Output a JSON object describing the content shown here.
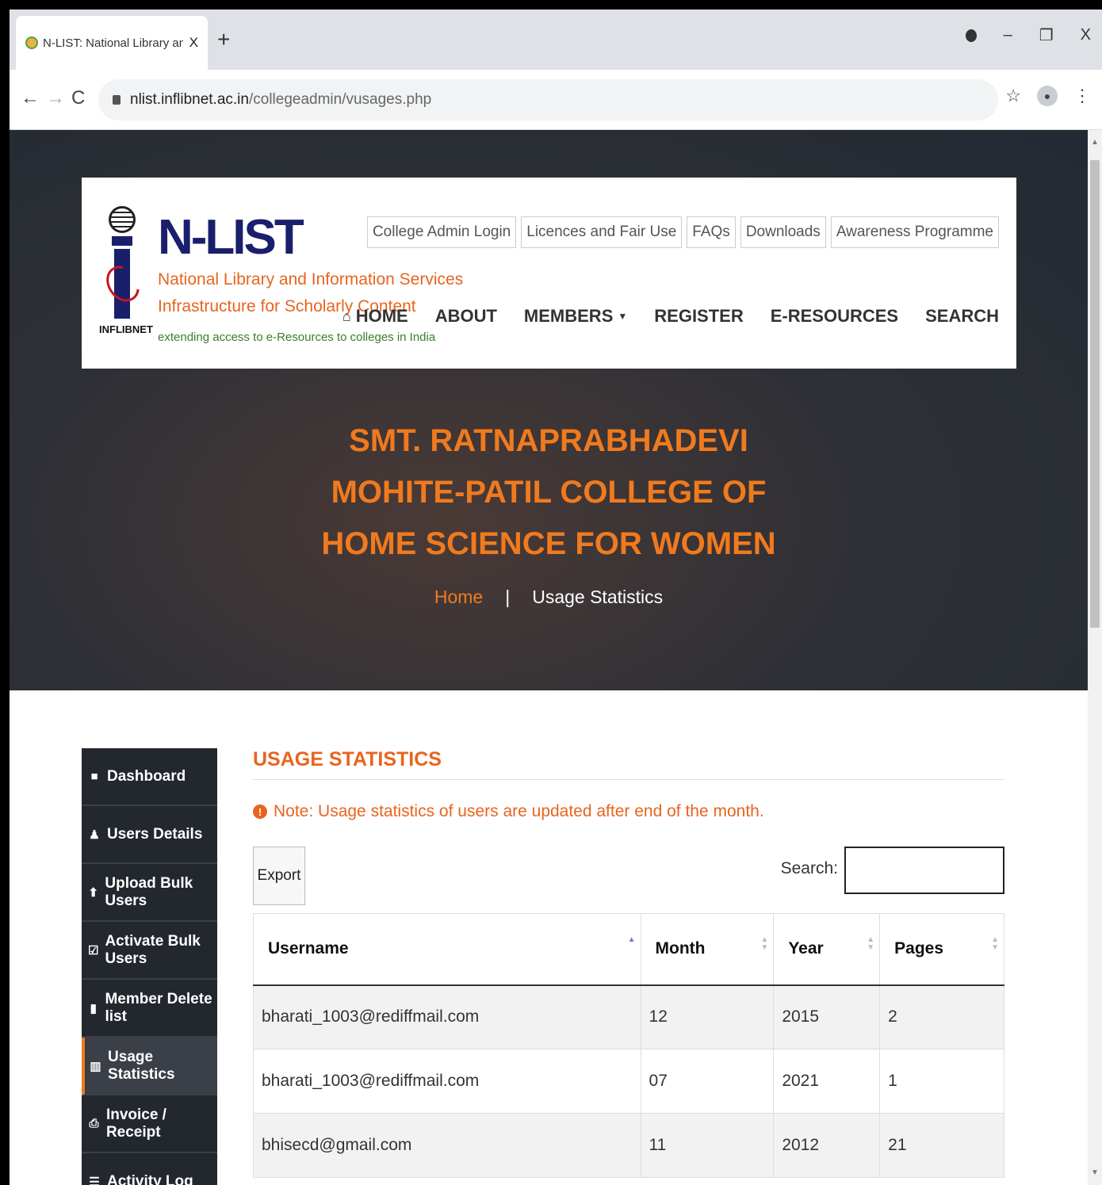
{
  "browser": {
    "tab_title": "N-LIST: National Library and Info",
    "url_host": "nlist.inflibnet.ac.in",
    "url_path": "/collegeadmin/vusages.php"
  },
  "header": {
    "logo_caption": "INFLIBNET",
    "brand_title": "N-LIST",
    "brand_sub1": "National Library and Information Services",
    "brand_sub2": "Infrastructure for Scholarly Content",
    "brand_sub3": "extending access to e-Resources to colleges in India",
    "top_links": [
      "College Admin Login",
      "Licences and Fair Use",
      "FAQs",
      "Downloads",
      "Awareness Programme"
    ],
    "nav": [
      "HOME",
      "ABOUT",
      "MEMBERS",
      "REGISTER",
      "E-RESOURCES",
      "SEARCH"
    ]
  },
  "hero": {
    "college_lines": [
      "SMT. RATNAPRABHADEVI",
      "MOHITE-PATIL COLLEGE OF",
      "HOME SCIENCE FOR WOMEN"
    ],
    "crumb_home": "Home",
    "crumb_sep": "|",
    "crumb_current": "Usage Statistics"
  },
  "sidebar": {
    "items": [
      {
        "label": "Dashboard",
        "icon": "dashboard-icon"
      },
      {
        "label": "Users Details",
        "icon": "users-icon"
      },
      {
        "label": "Upload Bulk Users",
        "icon": "upload-icon"
      },
      {
        "label": "Activate Bulk Users",
        "icon": "check-icon"
      },
      {
        "label": "Member Delete list",
        "icon": "trash-icon"
      },
      {
        "label": "Usage Statistics",
        "icon": "chart-icon"
      },
      {
        "label": "Invoice / Receipt",
        "icon": "print-icon"
      },
      {
        "label": "Activity Log",
        "icon": "list-icon"
      }
    ],
    "active": "Usage Statistics"
  },
  "content": {
    "title": "USAGE STATISTICS",
    "note": "Note: Usage statistics of users are updated after end of the month.",
    "export_label": "Export",
    "search_label": "Search:",
    "columns": [
      "Username",
      "Month",
      "Year",
      "Pages"
    ],
    "rows": [
      [
        "bharati_1003@rediffmail.com",
        "12",
        "2015",
        "2"
      ],
      [
        "bharati_1003@rediffmail.com",
        "07",
        "2021",
        "1"
      ],
      [
        "bhisecd@gmail.com",
        "11",
        "2012",
        "21"
      ]
    ]
  },
  "colors": {
    "accent": "#e8641e",
    "navy": "#1a1f6b",
    "sidebar_bg": "#23272e"
  }
}
